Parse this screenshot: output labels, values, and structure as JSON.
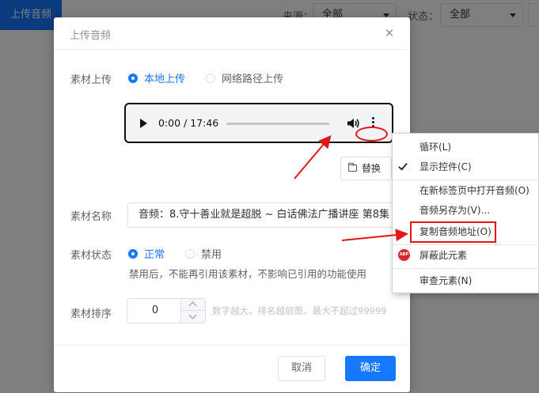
{
  "background": {
    "upload_button": "上传音频",
    "source_label": "来源：",
    "source_value": "全部",
    "status_label": "状态：",
    "status_value": "全部"
  },
  "dialog": {
    "title": "上传音频",
    "close_icon": "close-icon",
    "upload_label": "素材上传",
    "upload_options": [
      "本地上传",
      "网络路径上传"
    ],
    "upload_selected": "本地上传",
    "audio": {
      "time": "0:00 / 17:46",
      "progress": 0
    },
    "replace_button": "替换",
    "name_label": "素材名称",
    "name_value": "音频：8.守十善业就是超脱 ~ 白话佛法广播讲座 第8集",
    "status_label": "素材状态",
    "status_options": [
      "正常",
      "禁用"
    ],
    "status_selected": "正常",
    "status_hint": "禁用后，不能再引用该素材，不影响已引用的功能使用",
    "sort_label": "素材排序",
    "sort_value": "0",
    "sort_hint": "数字越大，排名越前面，最大不超过99999",
    "cancel_button": "取消",
    "confirm_button": "确定"
  },
  "context_menu": {
    "items": [
      {
        "label": "循环(L)",
        "icon": ""
      },
      {
        "label": "显示控件(C)",
        "icon": "check-icon"
      },
      {
        "label": "在新标签页中打开音频(O)",
        "icon": ""
      },
      {
        "label": "音频另存为(V)...",
        "icon": ""
      },
      {
        "label": "复制音频地址(O)",
        "icon": ""
      },
      {
        "label": "屏蔽此元素",
        "icon": "adblock-icon"
      },
      {
        "label": "审查元素(N)",
        "icon": ""
      }
    ],
    "adblock_badge": "ABP",
    "highlighted": "复制音频地址(O)"
  },
  "colors": {
    "primary": "#1677ff",
    "annotation": "#e41616"
  }
}
